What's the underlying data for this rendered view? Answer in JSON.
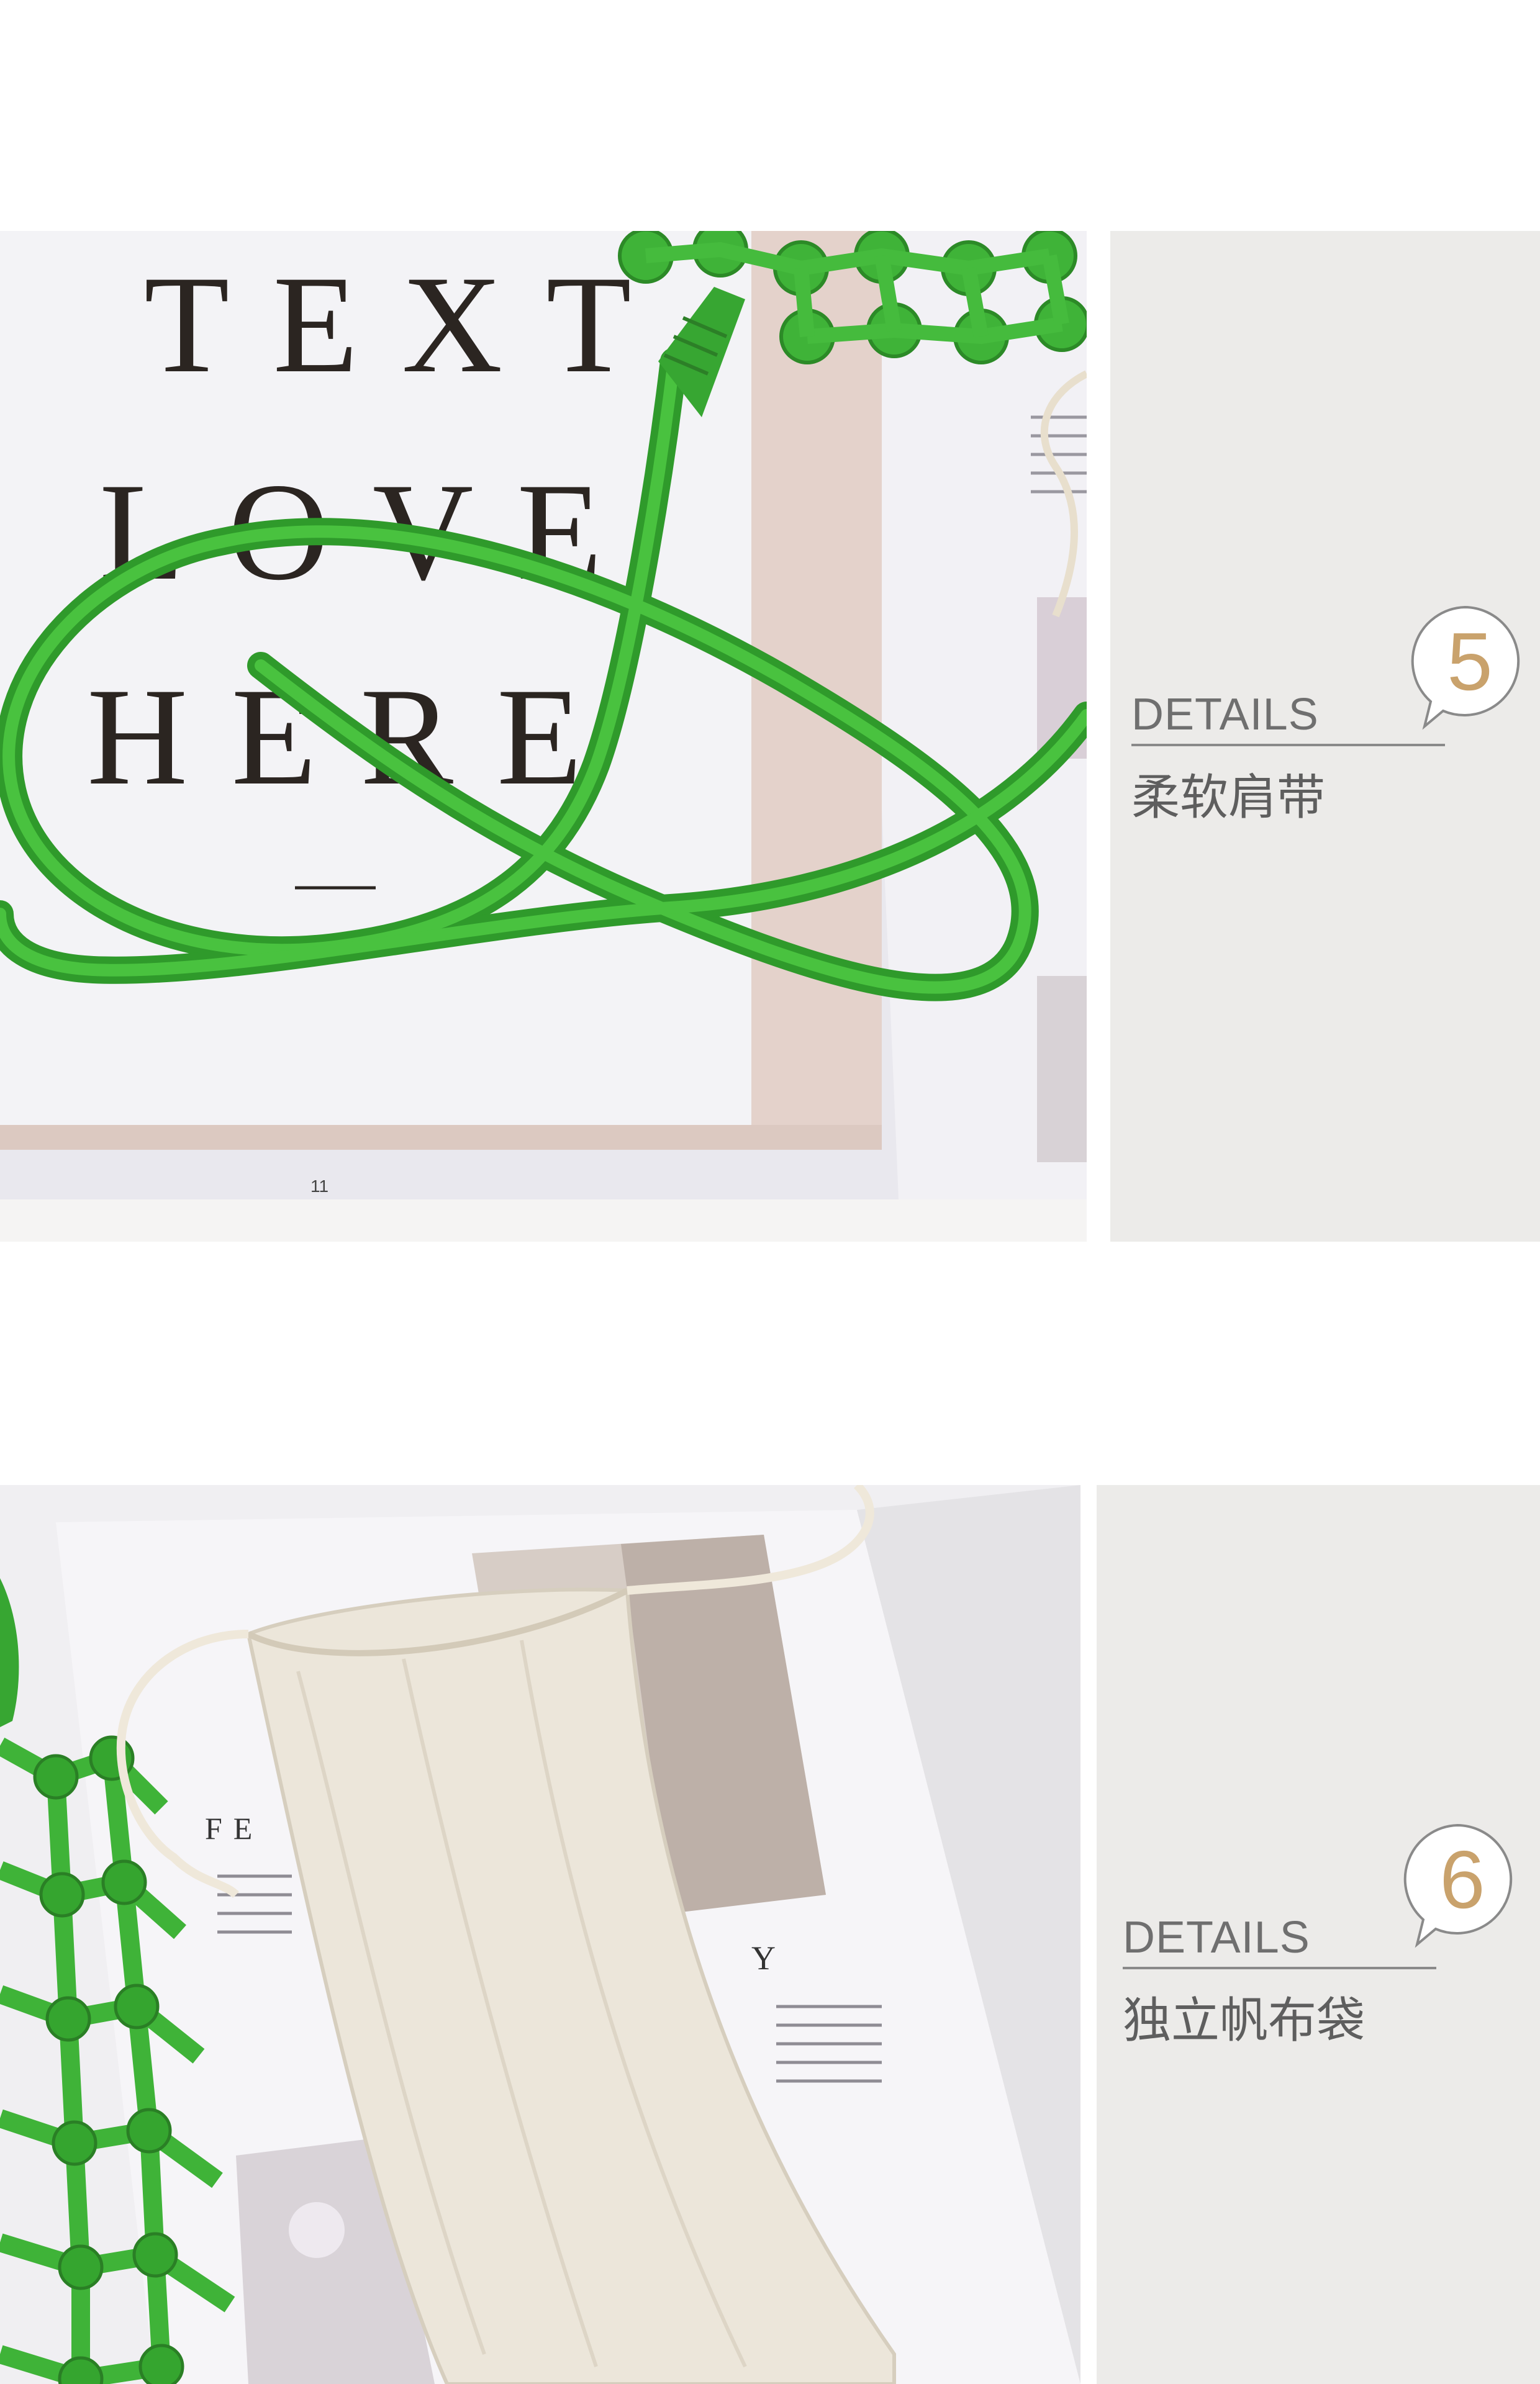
{
  "sections": [
    {
      "photo_description": "green woven bag shoulder strap on magazine page",
      "magazine_text": [
        "TEXT",
        "LOVE",
        "HERE"
      ],
      "page_number": "11",
      "callout": {
        "number": "5",
        "label": "DETAILS",
        "caption": "柔软肩带"
      }
    },
    {
      "photo_description": "canvas drawstring dust bag beside green woven bag",
      "magazine_text": [
        "FE",
        "Y"
      ],
      "callout": {
        "number": "6",
        "label": "DETAILS",
        "caption": "独立帆布袋"
      }
    }
  ],
  "colors": {
    "panel_background": "#ecebe9",
    "bubble_number": "#c9a26c",
    "strap_green": "#3cae34",
    "text_gray": "#6f6f6f"
  }
}
